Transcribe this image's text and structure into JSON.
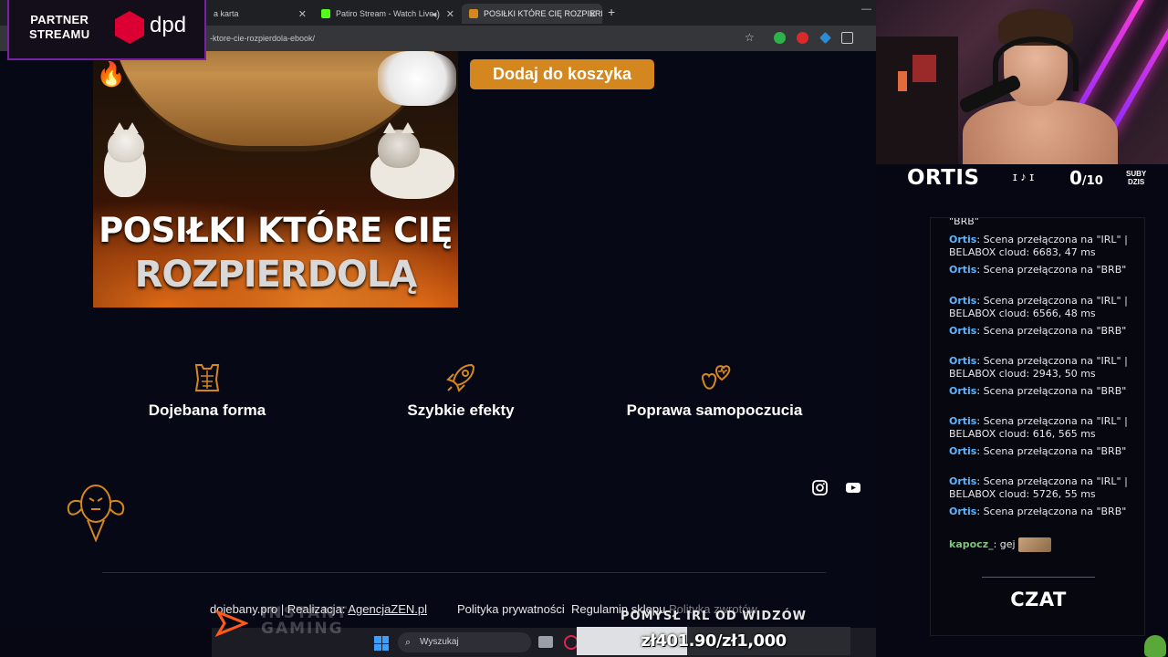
{
  "browser": {
    "tabs": [
      {
        "label": "a karta",
        "fav_color": "#4a4a4a"
      },
      {
        "label": "Patiro Stream - Watch Live",
        "fav_color": "#53fc18"
      },
      {
        "label": "POSIŁKI KTÓRE CIĘ ROZPIERDO",
        "fav_color": "#d4861f"
      }
    ],
    "url": "-ktore-cie-rozpierdola-ebook/"
  },
  "product": {
    "image_title_line1": "POSIŁKI KTÓRE CIĘ",
    "image_title_line2": "ROZPIERDOLĄ",
    "add_to_cart": "Dodaj do koszyka"
  },
  "features": [
    {
      "label": "Dojebana forma",
      "icon": "torso-icon"
    },
    {
      "label": "Szybkie efekty",
      "icon": "rocket-icon"
    },
    {
      "label": "Poprawa samopoczucia",
      "icon": "apple-heart-icon"
    }
  ],
  "footer": {
    "copyright": "dojebany.pro",
    "realizacja_label": "| Realizacja:",
    "realizacja_link": "AgencjaZEN.pl",
    "links": [
      "Polityka prywatności",
      "Regulamin sklepu",
      "Polityka zwrotów"
    ]
  },
  "taskbar": {
    "search_placeholder": "Wyszukaj"
  },
  "overlay": {
    "partner_line1": "PARTNER",
    "partner_line2": "STREAMU",
    "sponsor": "dpd",
    "streamer_name": "ORTIS",
    "subs_current": "0",
    "subs_goal": "/10",
    "subs_label_line1": "SUBY",
    "subs_label_line2": "DZIS",
    "instant_line1": "INSTANT",
    "instant_line2": "GAMING",
    "donation_title": "POMYSŁ IRL OD WIDZÓW",
    "donation_amount": "zł401.90/zł1,000",
    "donation_progress": 0.4019,
    "chat_label": "CZAT"
  },
  "chat": {
    "top_fragment": "\"BRB\"",
    "messages": [
      {
        "user": "Ortis",
        "text": "Scena przełączona na \"IRL\" | BELABOX cloud: 6683, 47 ms"
      },
      {
        "user": "Ortis",
        "text": "Scena przełączona na \"BRB\""
      },
      {
        "user": "Ortis",
        "text": "Scena przełączona na \"IRL\" | BELABOX cloud: 6566, 48 ms"
      },
      {
        "user": "Ortis",
        "text": "Scena przełączona na \"BRB\""
      },
      {
        "user": "Ortis",
        "text": "Scena przełączona na \"IRL\" | BELABOX cloud: 2943, 50 ms"
      },
      {
        "user": "Ortis",
        "text": "Scena przełączona na \"BRB\""
      },
      {
        "user": "Ortis",
        "text": "Scena przełączona na \"IRL\" | BELABOX cloud: 616, 565 ms"
      },
      {
        "user": "Ortis",
        "text": "Scena przełączona na \"BRB\""
      },
      {
        "user": "Ortis",
        "text": "Scena przełączona na \"IRL\" | BELABOX cloud: 5726, 55 ms"
      },
      {
        "user": "Ortis",
        "text": "Scena przełączona na \"BRB\""
      }
    ],
    "last_user": "kapocz_",
    "last_text": "gej"
  },
  "colors": {
    "accent_orange": "#d4861f",
    "site_bg": "#070815",
    "chat_user_blue": "#5fb4ff",
    "chat_user_green": "#7fc47a"
  }
}
